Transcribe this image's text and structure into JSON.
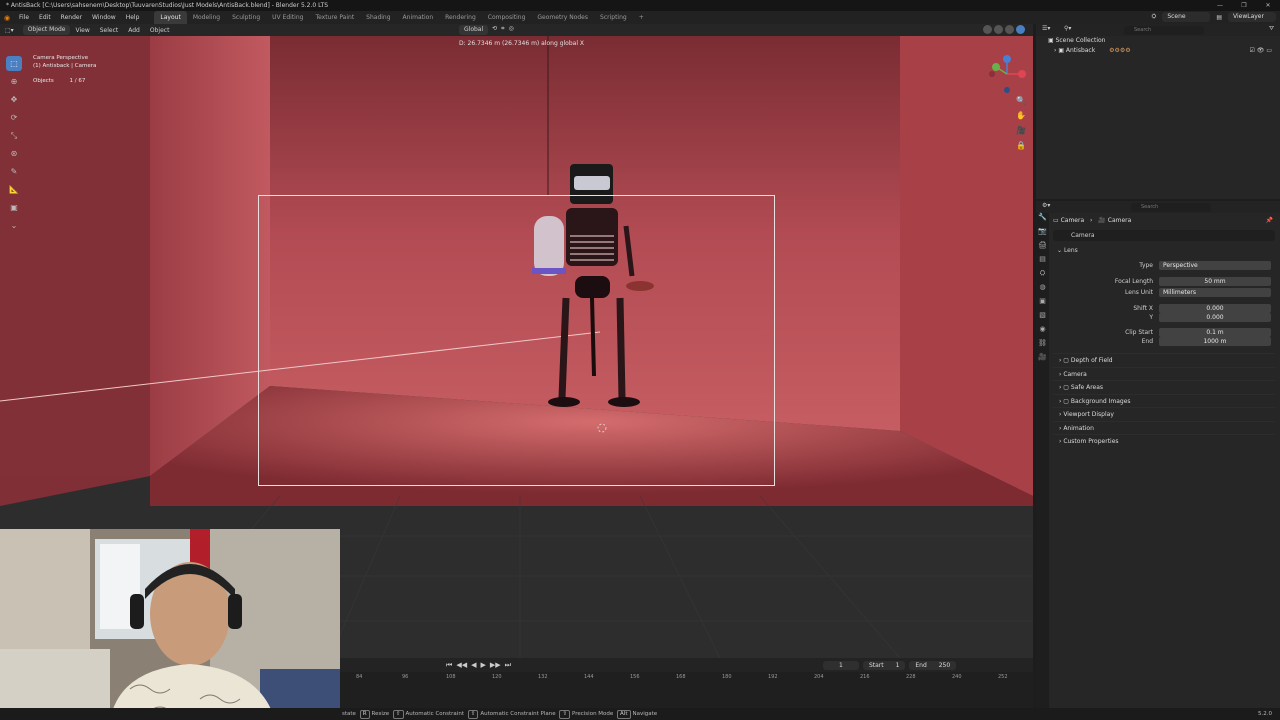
{
  "window": {
    "title": "* AntisBack [C:\\Users\\sahsenem\\Desktop\\TuuvarenStudios\\Just Models\\AntisBack.blend] - Blender 5.2.0 LTS",
    "controls": [
      "—",
      "❐",
      "✕"
    ]
  },
  "menu": {
    "items": [
      "File",
      "Edit",
      "Render",
      "Window",
      "Help"
    ],
    "workspaces": [
      "Layout",
      "Modeling",
      "Sculpting",
      "UV Editing",
      "Texture Paint",
      "Shading",
      "Animation",
      "Rendering",
      "Compositing",
      "Geometry Nodes",
      "Scripting"
    ],
    "active_workspace": "Layout",
    "add_workspace": "+",
    "scene_label": "Scene",
    "view_layer_label": "ViewLayer"
  },
  "viewport_header": {
    "mode": "Object Mode",
    "menus": [
      "View",
      "Select",
      "Add",
      "Object"
    ],
    "orientation": "Global"
  },
  "viewport": {
    "view_name": "Camera Perspective",
    "active_object": "(1) Antisback | Camera",
    "objects_label": "Objects",
    "objects_count": "1 / 67",
    "drag_text": "D: 26.7346 m (26.7346 m) along global X",
    "wall_color": "#b54b52",
    "floor_color": "#8f2f35"
  },
  "toolbar": {
    "tools": [
      "select-box-tool",
      "cursor-tool",
      "move-tool",
      "rotate-tool",
      "scale-tool",
      "transform-tool",
      "annotate-tool",
      "measure-tool",
      "add-cube-tool",
      "extra-tool"
    ]
  },
  "timeline": {
    "current_frame": "1",
    "start_label": "Start",
    "start": "1",
    "end_label": "End",
    "end": "250",
    "ticks": [
      "84",
      "96",
      "108",
      "120",
      "132",
      "144",
      "156",
      "168",
      "180",
      "192",
      "204",
      "216",
      "228",
      "240",
      "252"
    ]
  },
  "statusbar": {
    "items": [
      "state",
      "Resize",
      "Automatic Constraint",
      "Automatic Constraint Plane",
      "Precision Mode",
      "Navigate"
    ],
    "keys": [
      "R",
      "",
      "",
      "",
      "Alt"
    ],
    "version": "5.2.0"
  },
  "outliner": {
    "search_placeholder": "Search",
    "root": "Scene Collection",
    "collection": "Antisback"
  },
  "properties": {
    "search_placeholder": "Search",
    "breadcrumb": [
      "Camera",
      "Camera"
    ],
    "data_name": "Camera",
    "lens_section": "Lens",
    "type_label": "Type",
    "type_value": "Perspective",
    "focal_label": "Focal Length",
    "focal_value": "50 mm",
    "lens_unit_label": "Lens Unit",
    "lens_unit_value": "Millimeters",
    "shift_x_label": "Shift X",
    "shift_x_value": "0.000",
    "shift_y_label": "Y",
    "shift_y_value": "0.000",
    "clip_start_label": "Clip Start",
    "clip_start_value": "0.1 m",
    "clip_end_label": "End",
    "clip_end_value": "1000 m",
    "sections": [
      "Depth of Field",
      "Camera",
      "Safe Areas",
      "Background Images",
      "Viewport Display",
      "Animation",
      "Custom Properties"
    ]
  }
}
